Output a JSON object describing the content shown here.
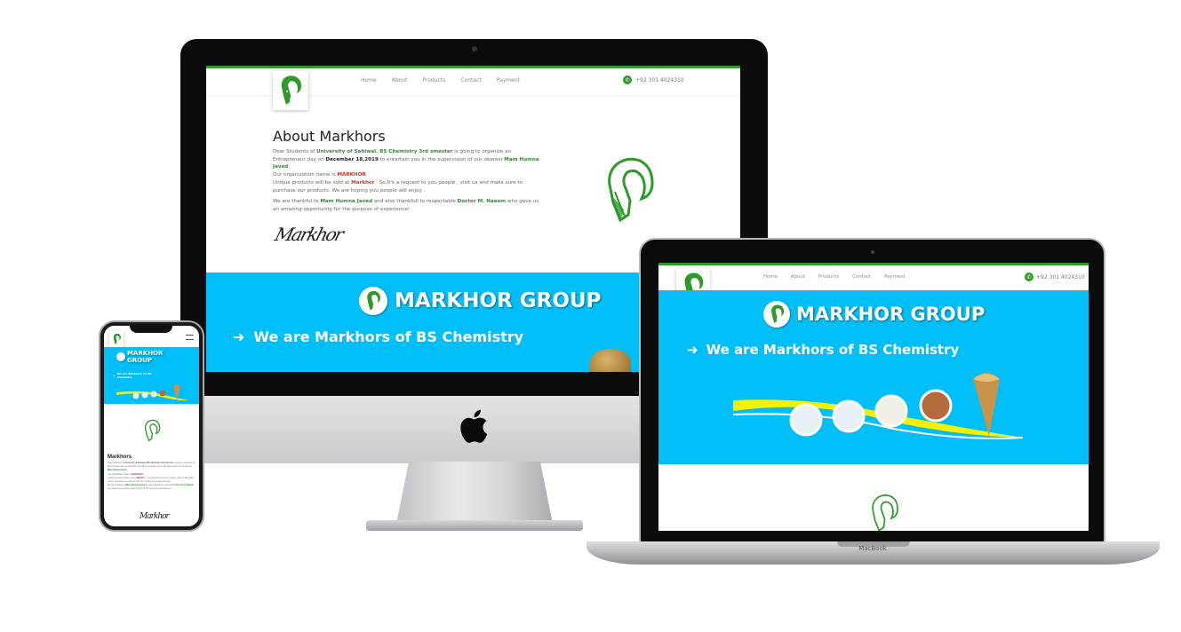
{
  "site": {
    "nav_items": [
      "Home",
      "About",
      "Products",
      "Contact",
      "Payment"
    ],
    "phone": "+92 301 4024310",
    "brand": "MARKHOR GROUP",
    "tagline": "We are Markhors of BS Chemistry"
  },
  "about": {
    "title": "About Markhors",
    "p1_a": "Dear Students of ",
    "p1_b": "University of Sahiwal, BS Chemistry 3rd smester",
    "p1_c": " is going to organize an Entrepreneur day on ",
    "p1_d": "December 18,2019",
    "p1_e": " to entertain you in the supervision of our dearest ",
    "p1_f": "Mam Humna Javed",
    "p1_g": ".",
    "p2_a": "Our organization name is ",
    "p2_b": "MARKHOR",
    "p2_c": ".",
    "p3_a": "Unique products will be sold at ",
    "p3_b": "Markhor",
    "p3_c": " . So,It's a request to you people , visit us and make sure to purchase our products. We are hoping you people will enjoy .",
    "p4_a": "We are thankful to ",
    "p4_b": "Mam Humna Javed",
    "p4_c": " and also thankfull to respectable ",
    "p4_d": "Doctor M. Naeem",
    "p4_e": " who gave us an amazing opportunity for the purpose of experience!",
    "signature": "Markhor"
  },
  "phone_view": {
    "heading": "Markhors"
  },
  "devices": {
    "laptop_label": "MacBook"
  },
  "colors": {
    "brand_green": "#2e9a2a",
    "hero_blue": "#00bff8"
  }
}
